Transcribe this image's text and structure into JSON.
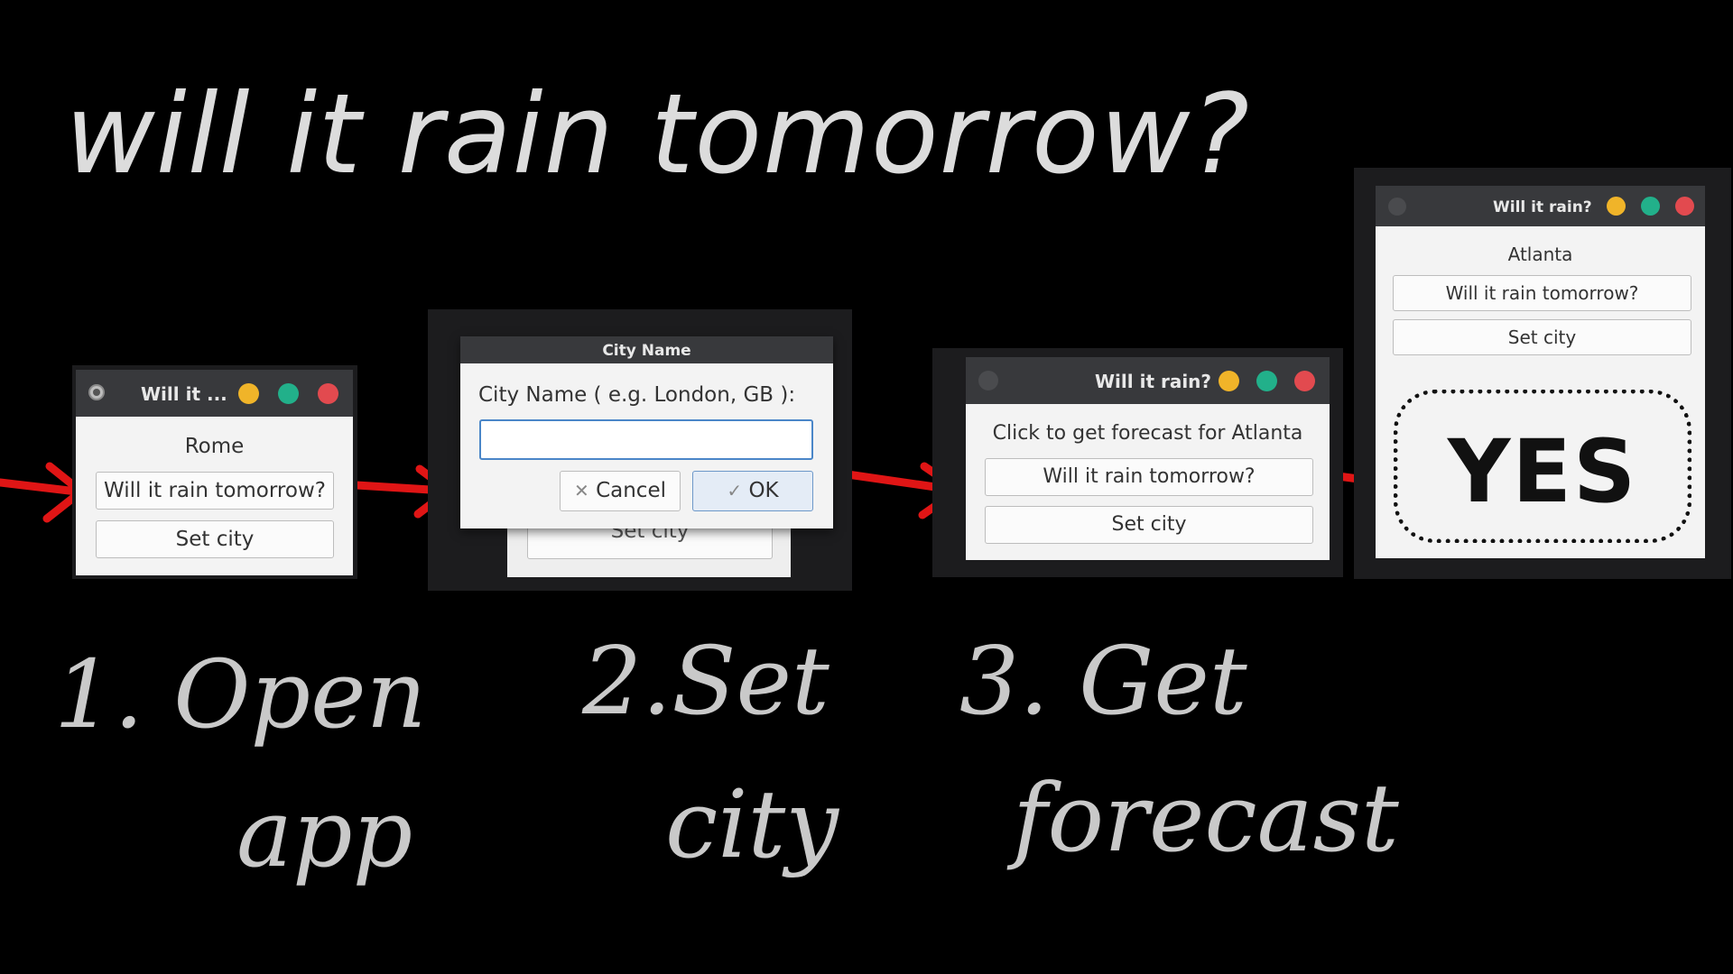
{
  "headline": "will it rain tomorrow?",
  "colors": {
    "background": "#000000",
    "arrow": "#e01515",
    "minimize": "#f0b429",
    "maximize": "#22b08a",
    "close": "#e24a4f"
  },
  "steps": [
    {
      "line1": "1. Open",
      "line2": "app"
    },
    {
      "line1": "2.Set",
      "line2": "city"
    },
    {
      "line1": "3. Get",
      "line2": "forecast"
    }
  ],
  "window1": {
    "title": "Will it ...",
    "city": "Rome",
    "rain_button": "Will it rain tomorrow?",
    "set_city_button": "Set city",
    "menu_icon": "circle-menu-icon"
  },
  "dialog": {
    "title": "City Name",
    "prompt": "City Name ( e.g. London, GB ):",
    "input_value": "",
    "cancel_label": "Cancel",
    "ok_label": "OK",
    "cancel_icon": "x-icon",
    "ok_icon": "check-icon",
    "behind_button": "Set city"
  },
  "window3": {
    "title": "Will it rain?",
    "status": "Click to get forecast for Atlanta",
    "rain_button": "Will it rain tomorrow?",
    "set_city_button": "Set city"
  },
  "window4": {
    "title": "Will it rain?",
    "city": "Atlanta",
    "rain_button": "Will it rain tomorrow?",
    "set_city_button": "Set city",
    "answer": "YES"
  }
}
